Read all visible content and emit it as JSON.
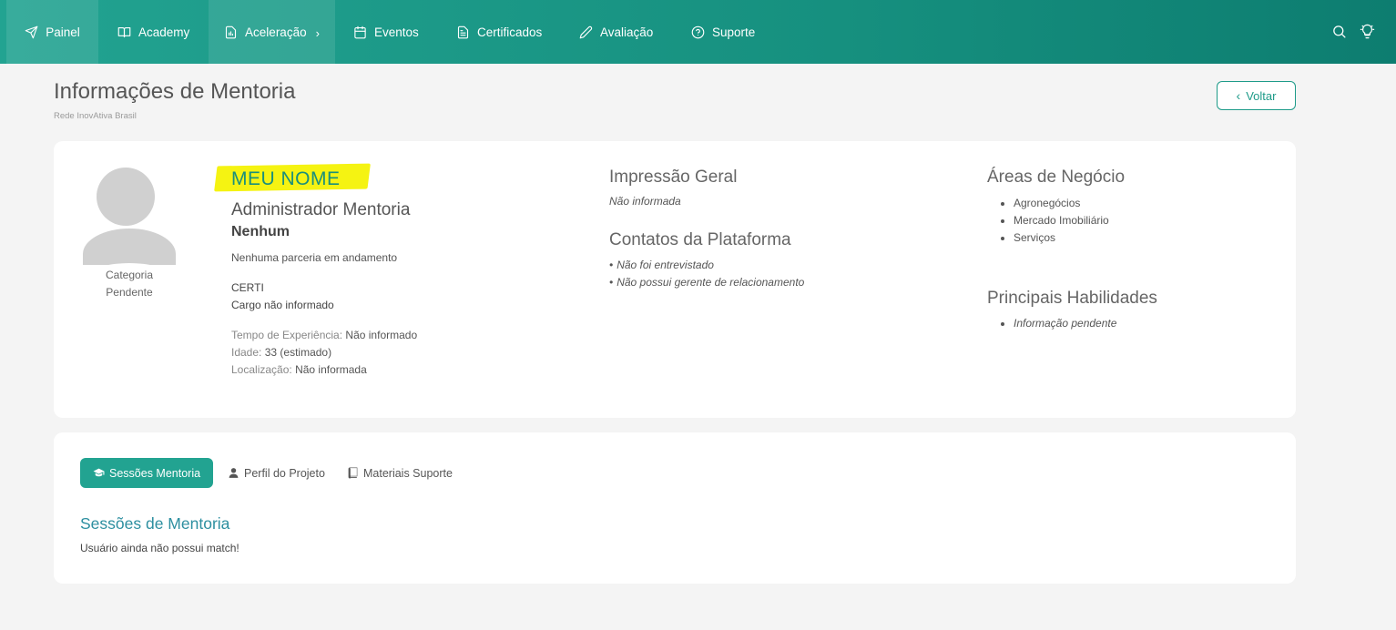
{
  "nav": {
    "items": [
      {
        "label": "Painel",
        "icon": "send-icon"
      },
      {
        "label": "Academy",
        "icon": "book-icon"
      },
      {
        "label": "Aceleração",
        "icon": "chart-file-icon",
        "chevron": "›"
      },
      {
        "label": "Eventos",
        "icon": "calendar-icon"
      },
      {
        "label": "Certificados",
        "icon": "document-icon"
      },
      {
        "label": "Avaliação",
        "icon": "pencil-icon"
      },
      {
        "label": "Suporte",
        "icon": "help-circle-icon"
      }
    ],
    "right_icons": [
      "search-icon",
      "lightbulb-icon"
    ]
  },
  "header": {
    "title": "Informações de Mentoria",
    "subtitle": "Rede InovAtiva Brasil",
    "back_label": "Voltar"
  },
  "profile": {
    "category_line1": "Categoria",
    "category_line2": "Pendente",
    "name": "MEU NOME",
    "highlight_color": "#f5f312",
    "role": "Administrador Mentoria",
    "institution": "Nenhum",
    "partnership": "Nenhuma parceria em andamento",
    "organization": "CERTI",
    "position": "Cargo não informado",
    "experience_label": "Tempo de Experiência:",
    "experience_value": "Não informado",
    "age_label": "Idade:",
    "age_value": "33 (estimado)",
    "location_label": "Localização:",
    "location_value": "Não informada"
  },
  "impressao": {
    "title": "Impressão Geral",
    "value": "Não informada"
  },
  "contatos": {
    "title": "Contatos da Plataforma",
    "items": [
      "Não foi entrevistado",
      "Não possui gerente de relacionamento"
    ]
  },
  "areas": {
    "title": "Áreas de Negócio",
    "items": [
      "Agronegócios",
      "Mercado Imobiliário",
      "Serviços"
    ]
  },
  "habilidades": {
    "title": "Principais Habilidades",
    "items": [
      "Informação pendente"
    ]
  },
  "tabs": [
    {
      "label": "Sessões Mentoria",
      "icon": "graduation-cap-icon"
    },
    {
      "label": "Perfil do Projeto",
      "icon": "user-icon"
    },
    {
      "label": "Materiais Suporte",
      "icon": "book-icon"
    }
  ],
  "sessions": {
    "title": "Sessões de Mentoria",
    "text": "Usuário ainda não possui match!"
  },
  "colors": {
    "primary": "#22a391",
    "accent_text": "#2d8fa0"
  }
}
